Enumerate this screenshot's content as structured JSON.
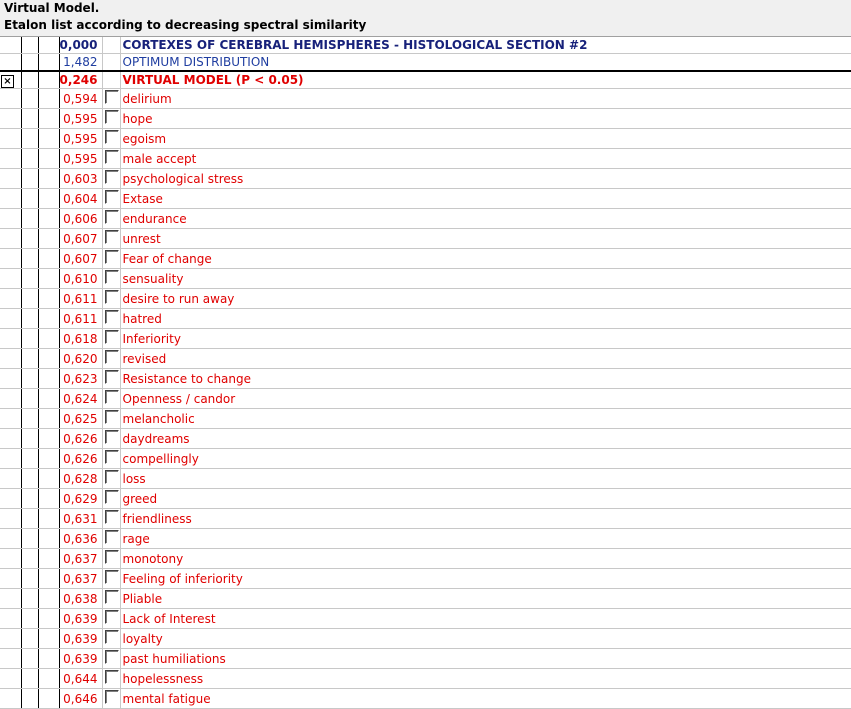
{
  "header": {
    "title": "Virtual Model.",
    "subtitle": "Etalon list according to decreasing spectral similarity"
  },
  "rows": [
    {
      "value": "0,000",
      "label": "CORTEXES OF CEREBRAL HEMISPHERES - HISTOLOGICAL SECTION #2",
      "style": "blue-bold",
      "checkbox": false,
      "marked": false
    },
    {
      "value": "1,482",
      "label": "OPTIMUM DISTRIBUTION",
      "style": "blue",
      "checkbox": false,
      "marked": false
    },
    {
      "value": "0,246",
      "label": "VIRTUAL MODEL (P < 0.05)",
      "style": "red-bold",
      "checkbox": false,
      "marked": true
    },
    {
      "value": "0,594",
      "label": "delirium",
      "style": "red",
      "checkbox": true,
      "marked": false
    },
    {
      "value": "0,595",
      "label": "hope",
      "style": "red",
      "checkbox": true,
      "marked": false
    },
    {
      "value": "0,595",
      "label": "egoism",
      "style": "red",
      "checkbox": true,
      "marked": false
    },
    {
      "value": "0,595",
      "label": "male accept",
      "style": "red",
      "checkbox": true,
      "marked": false
    },
    {
      "value": "0,603",
      "label": "psychological stress",
      "style": "red",
      "checkbox": true,
      "marked": false
    },
    {
      "value": "0,604",
      "label": "Extase",
      "style": "red",
      "checkbox": true,
      "marked": false
    },
    {
      "value": "0,606",
      "label": "endurance",
      "style": "red",
      "checkbox": true,
      "marked": false
    },
    {
      "value": "0,607",
      "label": "unrest",
      "style": "red",
      "checkbox": true,
      "marked": false
    },
    {
      "value": "0,607",
      "label": "Fear of change",
      "style": "red",
      "checkbox": true,
      "marked": false
    },
    {
      "value": "0,610",
      "label": "sensuality",
      "style": "red",
      "checkbox": true,
      "marked": false
    },
    {
      "value": "0,611",
      "label": "desire to run away",
      "style": "red",
      "checkbox": true,
      "marked": false
    },
    {
      "value": "0,611",
      "label": "hatred",
      "style": "red",
      "checkbox": true,
      "marked": false
    },
    {
      "value": "0,618",
      "label": "Inferiority",
      "style": "red",
      "checkbox": true,
      "marked": false
    },
    {
      "value": "0,620",
      "label": "revised",
      "style": "red",
      "checkbox": true,
      "marked": false
    },
    {
      "value": "0,623",
      "label": "Resistance to change",
      "style": "red",
      "checkbox": true,
      "marked": false
    },
    {
      "value": "0,624",
      "label": "Openness / candor",
      "style": "red",
      "checkbox": true,
      "marked": false
    },
    {
      "value": "0,625",
      "label": "melancholic",
      "style": "red",
      "checkbox": true,
      "marked": false
    },
    {
      "value": "0,626",
      "label": "daydreams",
      "style": "red",
      "checkbox": true,
      "marked": false
    },
    {
      "value": "0,626",
      "label": "compellingly",
      "style": "red",
      "checkbox": true,
      "marked": false
    },
    {
      "value": "0,628",
      "label": "loss",
      "style": "red",
      "checkbox": true,
      "marked": false
    },
    {
      "value": "0,629",
      "label": "greed",
      "style": "red",
      "checkbox": true,
      "marked": false
    },
    {
      "value": "0,631",
      "label": "friendliness",
      "style": "red",
      "checkbox": true,
      "marked": false
    },
    {
      "value": "0,636",
      "label": "rage",
      "style": "red",
      "checkbox": true,
      "marked": false
    },
    {
      "value": "0,637",
      "label": "monotony",
      "style": "red",
      "checkbox": true,
      "marked": false
    },
    {
      "value": "0,637",
      "label": "Feeling of inferiority",
      "style": "red",
      "checkbox": true,
      "marked": false
    },
    {
      "value": "0,638",
      "label": "Pliable",
      "style": "red",
      "checkbox": true,
      "marked": false
    },
    {
      "value": "0,639",
      "label": "Lack of Interest",
      "style": "red",
      "checkbox": true,
      "marked": false
    },
    {
      "value": "0,639",
      "label": "loyalty",
      "style": "red",
      "checkbox": true,
      "marked": false
    },
    {
      "value": "0,639",
      "label": "past humiliations",
      "style": "red",
      "checkbox": true,
      "marked": false
    },
    {
      "value": "0,644",
      "label": "hopelessness",
      "style": "red",
      "checkbox": true,
      "marked": false
    },
    {
      "value": "0,646",
      "label": "mental fatigue",
      "style": "red",
      "checkbox": true,
      "marked": false
    }
  ],
  "colors": {
    "red": "#e00000",
    "blue": "#1f3da0",
    "dark_blue": "#17217a"
  },
  "icons": {
    "marked": "x-mark-icon",
    "unchecked": "checkbox-icon"
  }
}
